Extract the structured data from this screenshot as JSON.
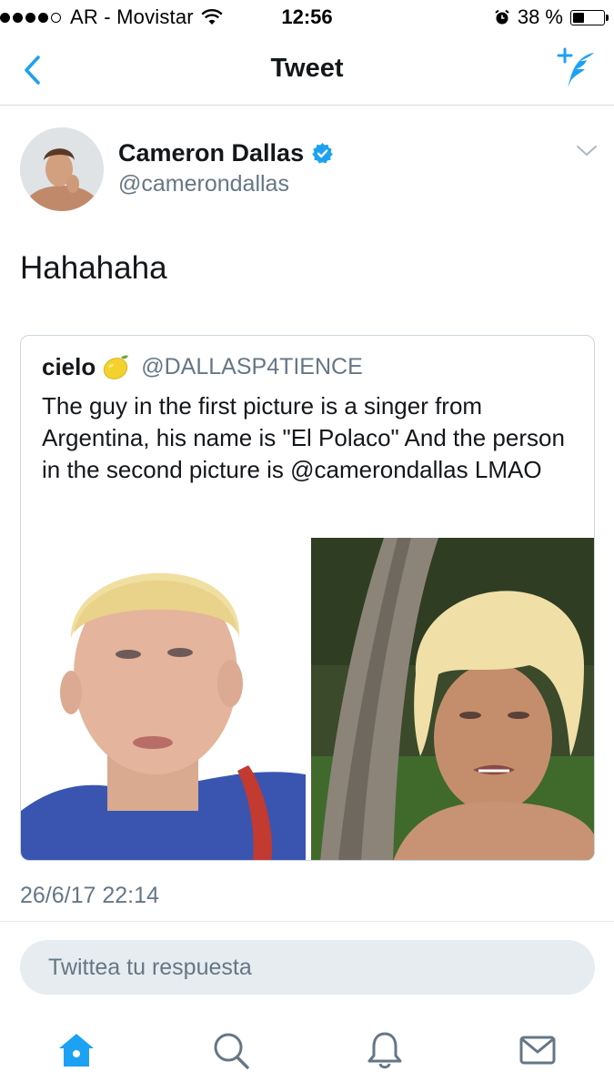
{
  "status_bar": {
    "carrier": "AR - Movistar",
    "time": "12:56",
    "battery_percent": "38 %",
    "battery_level": 0.38,
    "signal_bars": 4,
    "signal_total": 5
  },
  "nav": {
    "title": "Tweet",
    "back_icon": "chevron-left-icon",
    "compose_icon": "compose-tweet-icon"
  },
  "tweet": {
    "author_name": "Cameron Dallas",
    "author_handle": "@camerondallas",
    "verified": true,
    "text": "Hahahaha",
    "timestamp": "26/6/17 22:14"
  },
  "quoted_tweet": {
    "author_name": "cielo",
    "emoji": "lemon-emoji",
    "author_handle": "@DALLASP4TIENCE",
    "text": "The guy in the first picture is a singer from Argentina, his name is \"El Polaco\" And the person in the second picture is @camerondallas LMAO"
  },
  "reply": {
    "placeholder": "Twittea tu respuesta"
  },
  "tabbar": {
    "items": [
      "home-icon",
      "search-icon",
      "notifications-icon",
      "messages-icon"
    ]
  },
  "colors": {
    "accent": "#1da1f2",
    "text": "#14171a",
    "secondary": "#657786",
    "border": "#e1e8ed"
  }
}
